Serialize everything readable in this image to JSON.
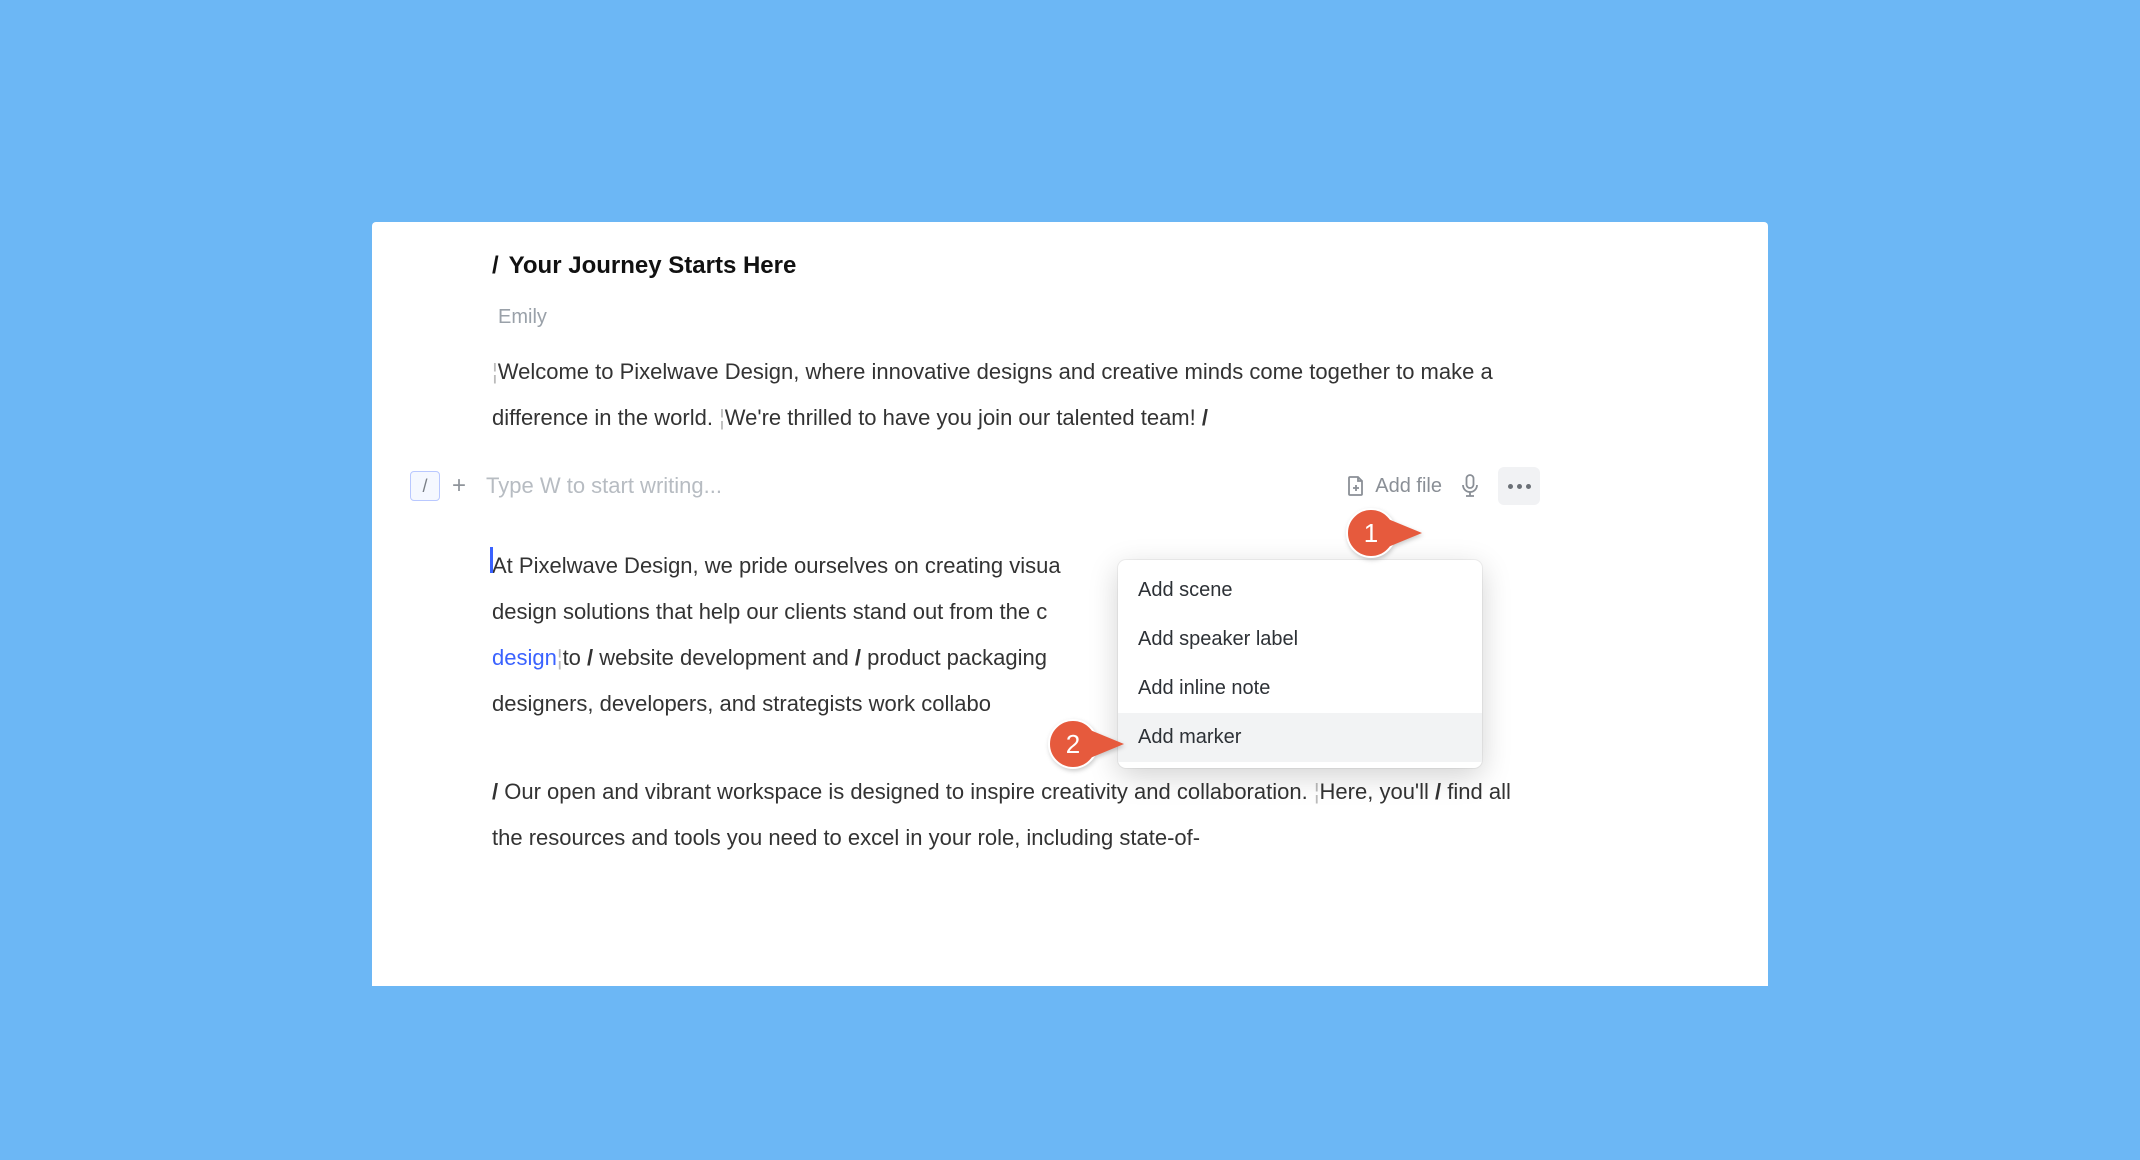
{
  "header": {
    "slash": "/",
    "title": "Your Journey Starts Here"
  },
  "author": "Emily",
  "paragraph1": {
    "s1": "Welcome to Pixelwave Design, where innovative designs and creative minds come together to make a difference in the world.",
    "s2": "We're thrilled to have you join our talented team!",
    "end_slash": "/"
  },
  "input": {
    "slash": "/",
    "plus": "+",
    "placeholder": "Type W to start writing...",
    "add_file": "Add file"
  },
  "paragraph2": {
    "pre": "At Pixelwave Design, we pride ourselves on creating visua",
    "cont1": "design solutions that help our clients stand out from the c",
    "link": "design",
    "mid1": "to",
    "slash1": "/",
    "mid2": "website development and",
    "slash2": "/",
    "mid3": "product packaging",
    "cont2": "designers, developers, and strategists work collabo"
  },
  "paragraph3": {
    "slash1": "/",
    "t1": "Our open and vibrant workspace is designed to inspire creativity and collaboration.",
    "t2": "Here, you'll",
    "slash2": "/",
    "t3": "find all the resources and tools you need to excel in your role, including state-of-"
  },
  "dropdown": {
    "items": [
      "Add scene",
      "Add speaker label",
      "Add inline note",
      "Add marker"
    ],
    "highlight_index": 3
  },
  "callouts": {
    "c1": "1",
    "c2": "2"
  }
}
